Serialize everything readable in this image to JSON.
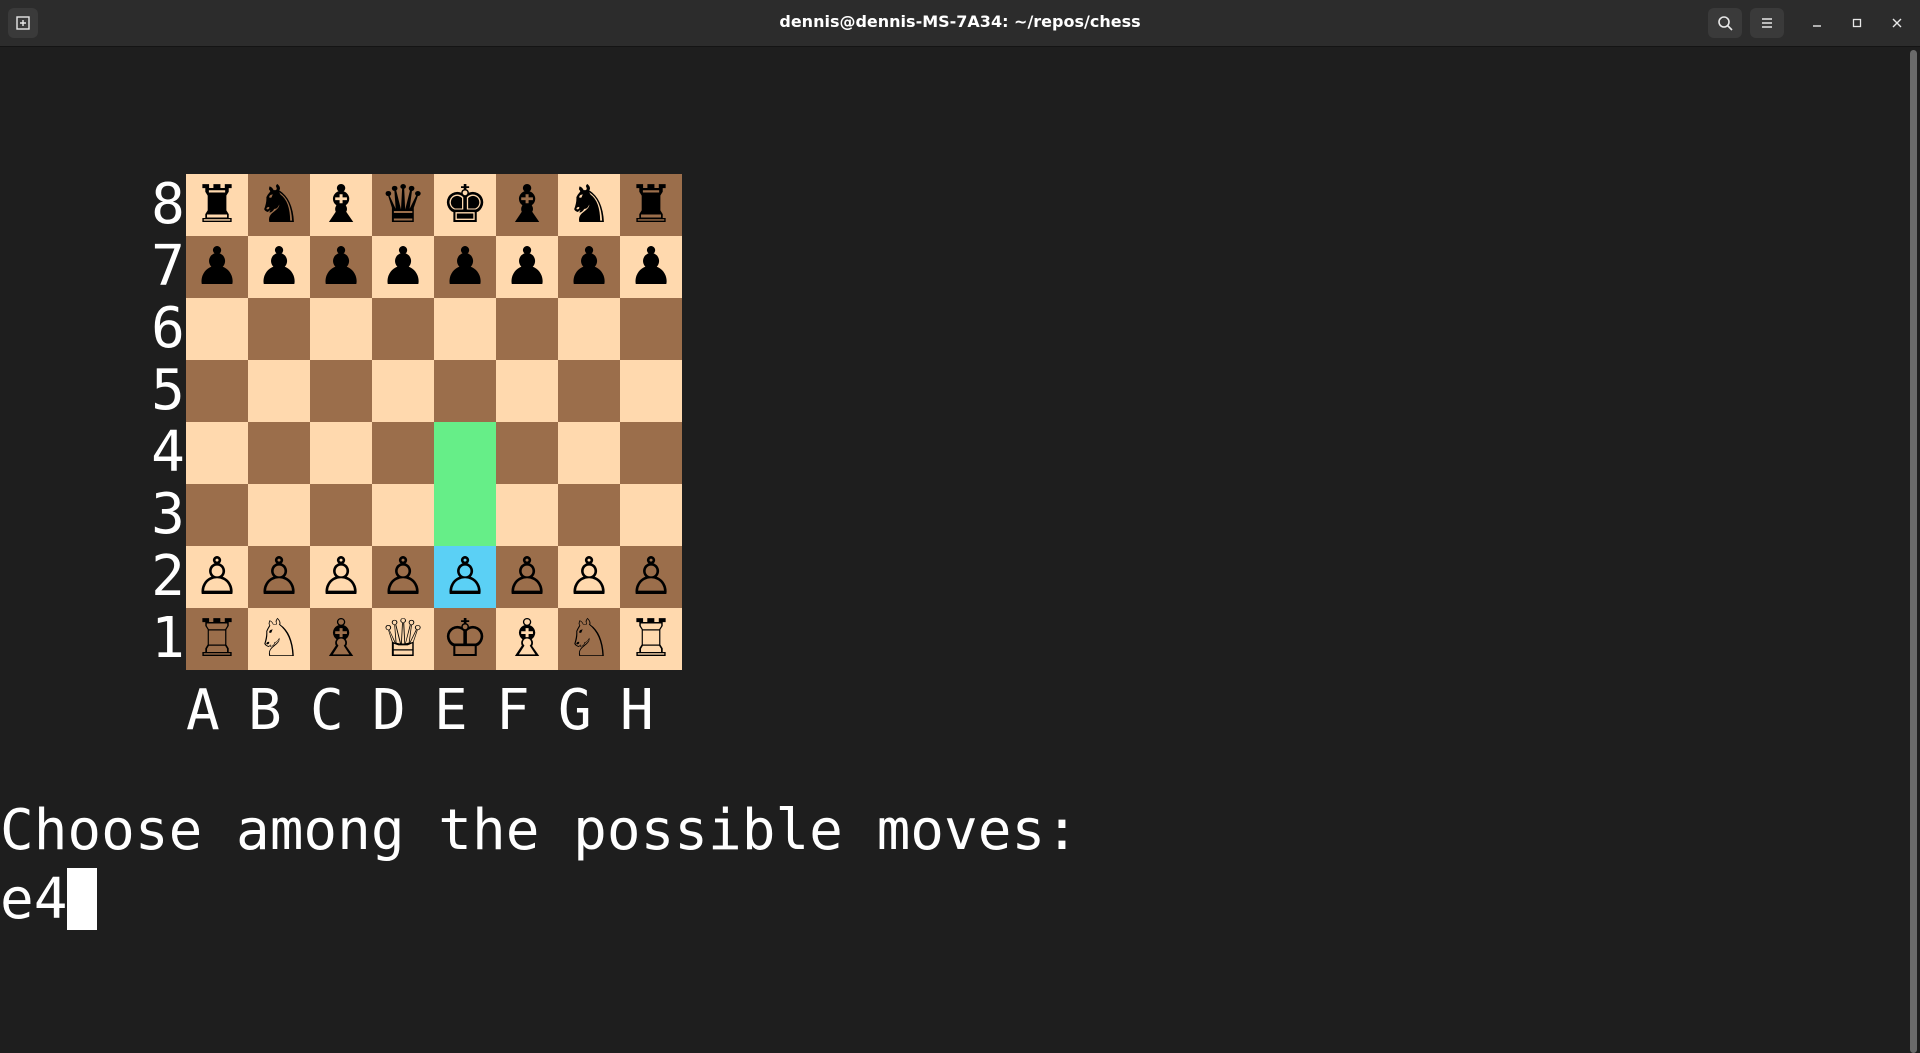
{
  "window": {
    "title": "dennis@dennis-MS-7A34: ~/repos/chess",
    "buttons": {
      "new_tab": "new-tab-icon",
      "search": "search-icon",
      "menu": "hamburger-menu-icon",
      "minimize": "minimize-icon",
      "maximize": "maximize-icon",
      "close": "close-icon"
    }
  },
  "colors": {
    "light_square": "#ffd9ae",
    "dark_square": "#9b6e4b",
    "highlight_move": "#66ee88",
    "highlight_selected": "#5bd0f5",
    "terminal_bg": "#1e1e1e"
  },
  "board": {
    "rank_labels": [
      "8",
      "7",
      "6",
      "5",
      "4",
      "3",
      "2",
      "1"
    ],
    "file_labels": [
      "A",
      "B",
      "C",
      "D",
      "E",
      "F",
      "G",
      "H"
    ],
    "rows": [
      [
        "♜",
        "♞",
        "♝",
        "♛",
        "♚",
        "♝",
        "♞",
        "♜"
      ],
      [
        "♟",
        "♟",
        "♟",
        "♟",
        "♟",
        "♟",
        "♟",
        "♟"
      ],
      [
        "",
        "",
        "",
        "",
        "",
        "",
        "",
        ""
      ],
      [
        "",
        "",
        "",
        "",
        "",
        "",
        "",
        ""
      ],
      [
        "",
        "",
        "",
        "",
        "",
        "",
        "",
        ""
      ],
      [
        "",
        "",
        "",
        "",
        "",
        "",
        "",
        ""
      ],
      [
        "♙",
        "♙",
        "♙",
        "♙",
        "♙",
        "♙",
        "♙",
        "♙"
      ],
      [
        "♖",
        "♘",
        "♗",
        "♕",
        "♔",
        "♗",
        "♘",
        "♖"
      ]
    ],
    "highlighted_moves": [
      "e4",
      "e3"
    ],
    "selected_square": "e2"
  },
  "terminal": {
    "prompt": "Choose among the possible moves:",
    "input": "e4"
  }
}
